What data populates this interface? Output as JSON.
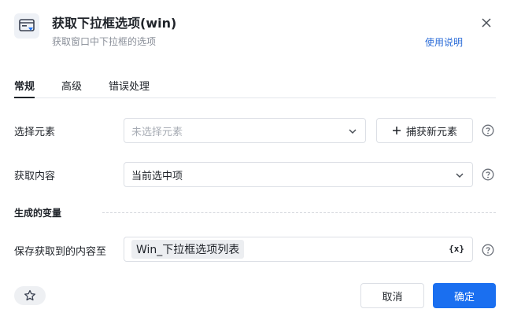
{
  "header": {
    "icon": "dropdown-window-icon",
    "title": "获取下拉框选项(win)",
    "subtitle": "获取窗口中下拉框的选项",
    "help_link": "使用说明",
    "close_icon": "close-icon"
  },
  "tabs": [
    {
      "label": "常规",
      "active": true
    },
    {
      "label": "高级",
      "active": false
    },
    {
      "label": "错误处理",
      "active": false
    }
  ],
  "form": {
    "element": {
      "label": "选择元素",
      "placeholder": "未选择元素",
      "capture_button": "捕获新元素"
    },
    "content": {
      "label": "获取内容",
      "value": "当前选中项"
    },
    "section_title": "生成的变量",
    "output": {
      "label": "保存获取到的内容至",
      "variable": "Win_下拉框选项列表",
      "variable_icon": "{x}"
    }
  },
  "footer": {
    "star_icon": "star-icon",
    "cancel": "取消",
    "ok": "确定"
  },
  "colors": {
    "primary": "#1a6ff0",
    "link": "#2b6cd8",
    "border": "#dcdfe5"
  }
}
